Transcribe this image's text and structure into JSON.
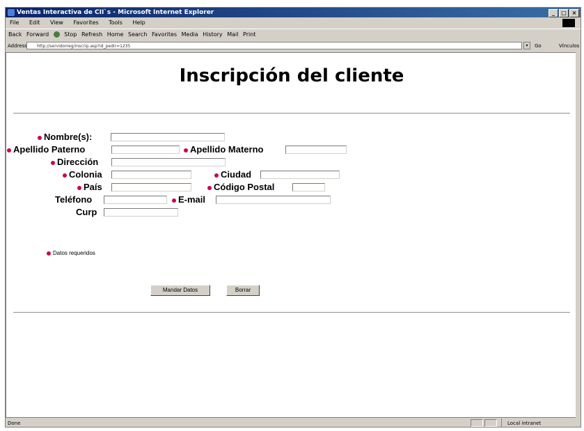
{
  "window": {
    "title": "Ventas Interactiva de CII`s - Microsoft Internet Explorer",
    "controls": [
      "_",
      "□",
      "×"
    ]
  },
  "menu": [
    "File",
    "Edit",
    "View",
    "Favorites",
    "Tools",
    "Help"
  ],
  "toolbar": [
    "Back",
    "Forward",
    "Stop",
    "Refresh",
    "Home",
    "Search",
    "Favorites",
    "Media",
    "History",
    "Mail",
    "Print"
  ],
  "address": {
    "label": "Address",
    "url": "http://servidorreg/inscrip.asp?id_pedir=1235",
    "go_label": "Go",
    "links_label": "Vínculos"
  },
  "page": {
    "title": "Inscripción del cliente"
  },
  "form": {
    "nombre_label": "Nombre(s):",
    "apellido_paterno_label": "Apellido Paterno",
    "apellido_materno_label": "Apellido Materno",
    "direccion_label": "Dirección",
    "colonia_label": "Colonia",
    "ciudad_label": "Ciudad",
    "pais_label": "País",
    "codigo_postal_label": "Código Postal",
    "telefono_label": "Teléfono",
    "email_label": "E-mail",
    "curp_label": "Curp"
  },
  "legend": {
    "text": "Datos requeridos"
  },
  "buttons": {
    "submit": "Mandar Datos",
    "reset": "Borrar"
  },
  "status": {
    "text": "Done",
    "zone": "Local intranet"
  },
  "colors": {
    "required_dot": "#cc0055",
    "title_gradient_start": "#0a246a",
    "chrome": "#d4d0c8"
  }
}
